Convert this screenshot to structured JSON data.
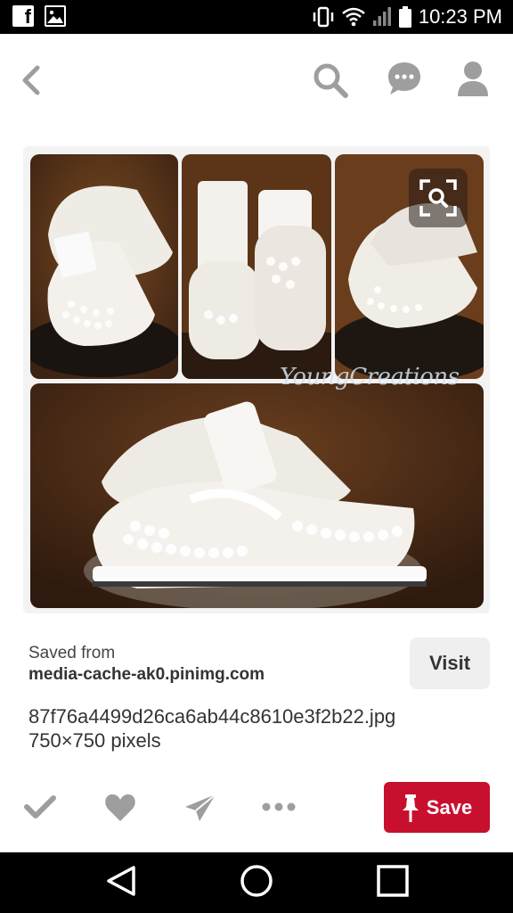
{
  "status_bar": {
    "time": "10:23 PM",
    "icons": [
      "facebook-icon",
      "gallery-icon",
      "vibrate-icon",
      "wifi-icon",
      "signal-icon",
      "battery-icon"
    ]
  },
  "nav": {
    "icons": [
      "back-icon",
      "search-icon",
      "chat-icon",
      "profile-icon"
    ]
  },
  "pin": {
    "watermark": "YoungCreations",
    "colors": {
      "photo_bg": "#5a3418",
      "photo_bg_dark": "#2b1a10",
      "shoe": "#f2efea"
    }
  },
  "source": {
    "saved_from_label": "Saved from",
    "domain": "media-cache-ak0.pinimg.com",
    "visit_label": "Visit"
  },
  "file": {
    "name": "87f76a4499d26ca6ab44c8610e3f2b22.jpg",
    "dimensions": "750×750 pixels"
  },
  "actions": {
    "icons": [
      "check-icon",
      "heart-icon",
      "send-icon",
      "more-icon"
    ],
    "save_label": "Save",
    "save_color": "#c8102e"
  },
  "android_nav": {
    "icons": [
      "back-triangle-icon",
      "home-circle-icon",
      "recents-square-icon"
    ]
  }
}
